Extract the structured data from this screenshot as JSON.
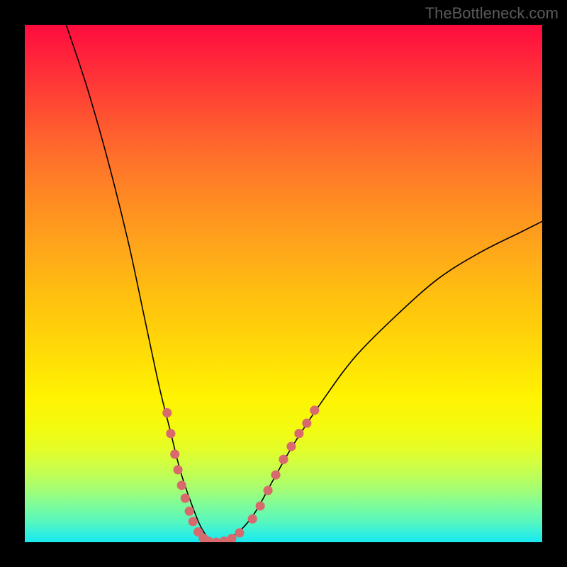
{
  "watermark": "TheBottleneck.com",
  "chart_data": {
    "type": "line",
    "title": "",
    "xlabel": "",
    "ylabel": "",
    "xlim": [
      0,
      100
    ],
    "ylim": [
      0,
      100
    ],
    "gradient_stops": [
      {
        "pos": 0,
        "color": "#ff0b3e"
      },
      {
        "pos": 100,
        "color": "#17e9f0"
      }
    ],
    "curve_left": [
      {
        "x": 8,
        "y": 100
      },
      {
        "x": 12,
        "y": 88
      },
      {
        "x": 16,
        "y": 74
      },
      {
        "x": 20,
        "y": 58
      },
      {
        "x": 23,
        "y": 44
      },
      {
        "x": 26,
        "y": 30
      },
      {
        "x": 28,
        "y": 22
      },
      {
        "x": 30,
        "y": 14
      },
      {
        "x": 32,
        "y": 8
      },
      {
        "x": 34,
        "y": 3
      },
      {
        "x": 36,
        "y": 0
      }
    ],
    "curve_right": [
      {
        "x": 36,
        "y": 0
      },
      {
        "x": 40,
        "y": 1
      },
      {
        "x": 44,
        "y": 5
      },
      {
        "x": 48,
        "y": 12
      },
      {
        "x": 52,
        "y": 19
      },
      {
        "x": 58,
        "y": 28
      },
      {
        "x": 64,
        "y": 36
      },
      {
        "x": 72,
        "y": 44
      },
      {
        "x": 80,
        "y": 51
      },
      {
        "x": 88,
        "y": 56
      },
      {
        "x": 96,
        "y": 60
      },
      {
        "x": 100,
        "y": 62
      }
    ],
    "highlight_points_left": [
      {
        "x": 27.5,
        "y": 25
      },
      {
        "x": 28.2,
        "y": 21
      },
      {
        "x": 29.0,
        "y": 17
      },
      {
        "x": 29.6,
        "y": 14
      },
      {
        "x": 30.3,
        "y": 11
      },
      {
        "x": 31.0,
        "y": 8.5
      },
      {
        "x": 31.8,
        "y": 6
      },
      {
        "x": 32.5,
        "y": 4
      },
      {
        "x": 33.5,
        "y": 2
      },
      {
        "x": 34.5,
        "y": 0.8
      }
    ],
    "highlight_points_bottom": [
      {
        "x": 35.5,
        "y": 0.2
      },
      {
        "x": 37.0,
        "y": 0
      },
      {
        "x": 38.5,
        "y": 0.2
      },
      {
        "x": 40.0,
        "y": 0.7
      },
      {
        "x": 41.5,
        "y": 1.8
      }
    ],
    "highlight_points_right": [
      {
        "x": 44.0,
        "y": 4.5
      },
      {
        "x": 45.5,
        "y": 7
      },
      {
        "x": 47.0,
        "y": 10
      },
      {
        "x": 48.5,
        "y": 13
      },
      {
        "x": 50.0,
        "y": 16
      },
      {
        "x": 51.5,
        "y": 18.5
      },
      {
        "x": 53.0,
        "y": 21
      },
      {
        "x": 54.5,
        "y": 23
      },
      {
        "x": 56.0,
        "y": 25.5
      }
    ],
    "dot_radius_data_units": 0.9
  }
}
